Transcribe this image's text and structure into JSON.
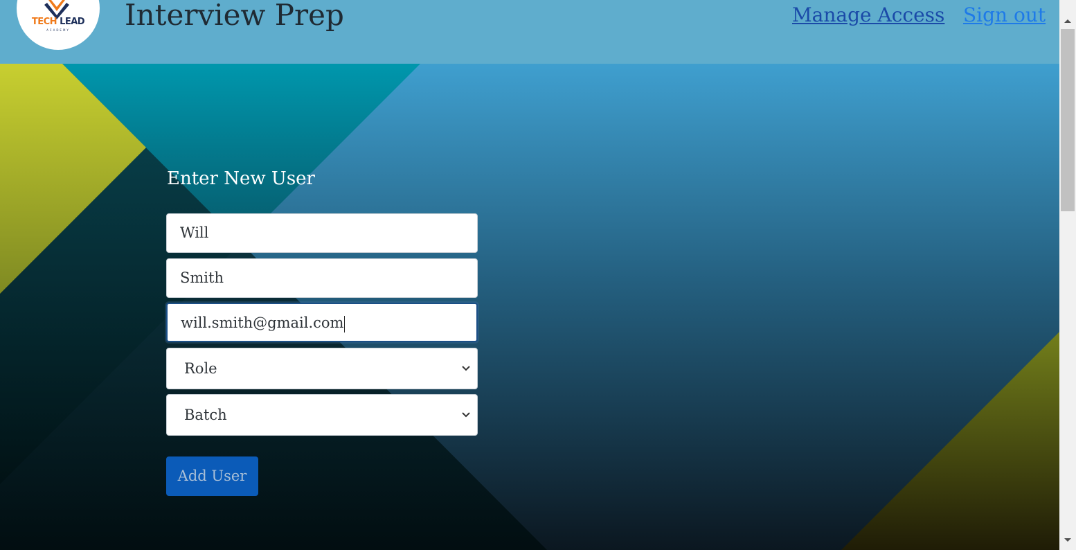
{
  "header": {
    "logo": {
      "line1": "TECH",
      "line2": "LEAD",
      "sub": "ACADEMY"
    },
    "title": "Interview Prep",
    "nav": {
      "manage_access": "Manage Access",
      "sign_out": "Sign out"
    }
  },
  "form": {
    "title": "Enter New User",
    "first_name": {
      "value": "Will"
    },
    "last_name": {
      "value": "Smith"
    },
    "email": {
      "value": "will.smith@gmail.com"
    },
    "role": {
      "selected": "Role"
    },
    "batch": {
      "selected": "Batch"
    },
    "submit_label": "Add User"
  },
  "colors": {
    "header_bg": "#5fadcd",
    "primary_button": "#0b5bb8",
    "nav_link": "#1a4aa8",
    "nav_link_alt": "#1e7ae8"
  }
}
